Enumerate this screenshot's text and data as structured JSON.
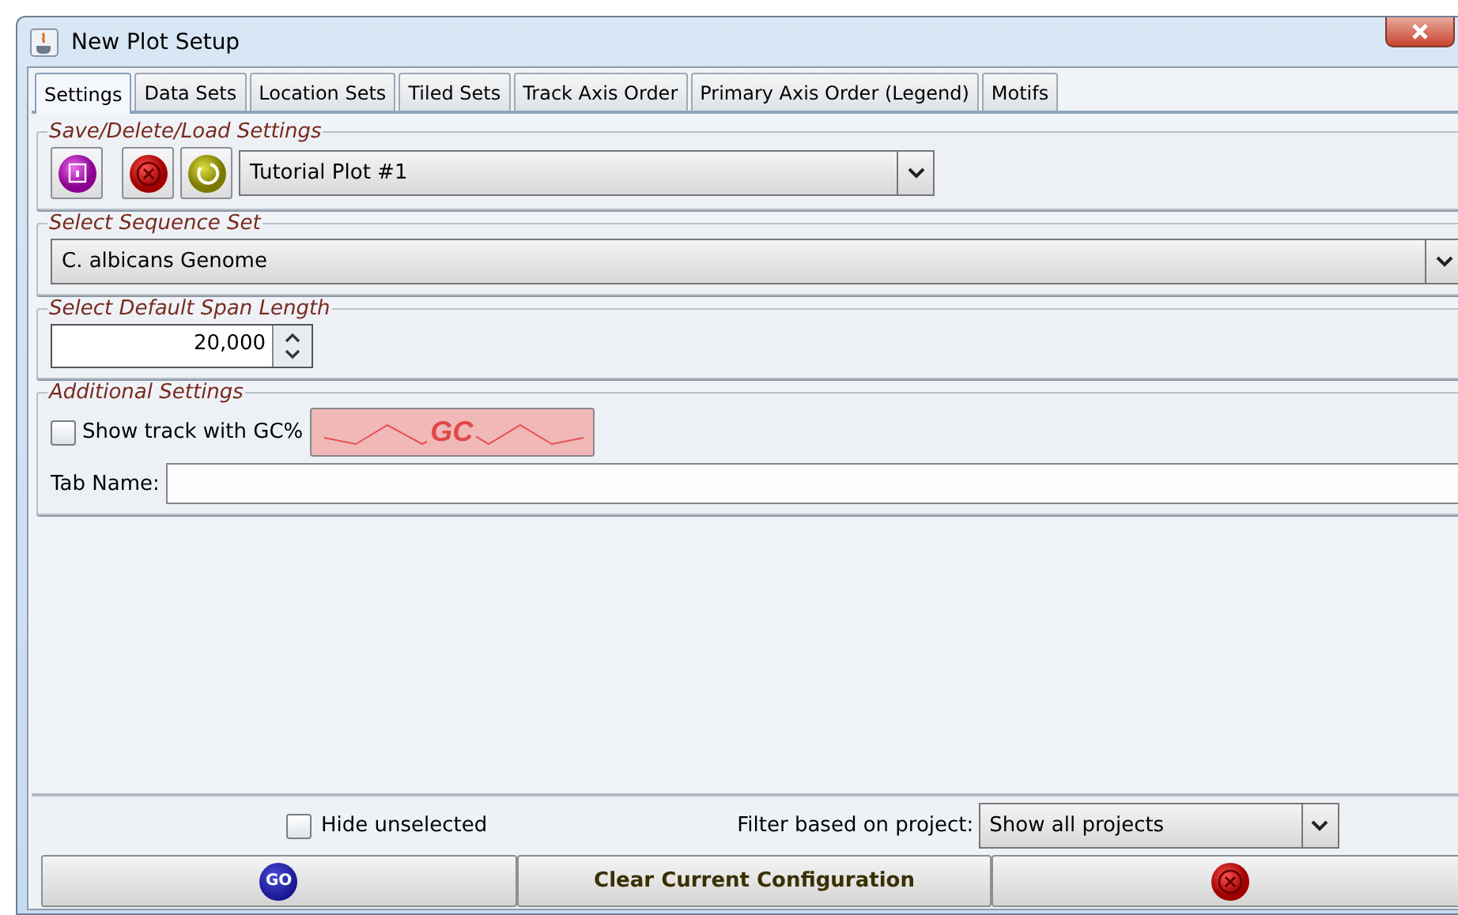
{
  "window": {
    "title": "New Plot Setup"
  },
  "tabs": [
    {
      "label": "Settings",
      "selected": true
    },
    {
      "label": "Data Sets",
      "selected": false
    },
    {
      "label": "Location Sets",
      "selected": false
    },
    {
      "label": "Tiled Sets",
      "selected": false
    },
    {
      "label": "Track Axis Order",
      "selected": false
    },
    {
      "label": "Primary Axis Order (Legend)",
      "selected": false
    },
    {
      "label": "Motifs",
      "selected": false
    }
  ],
  "save_settings": {
    "title": "Save/Delete/Load Settings",
    "selected_setting": "Tutorial Plot #1"
  },
  "sequence_set": {
    "title": "Select Sequence Set",
    "value": "C. albicans Genome"
  },
  "span_length": {
    "title": "Select Default Span Length",
    "value": "20,000"
  },
  "additional": {
    "title": "Additional Settings",
    "gc_label": "Show track with GC%",
    "gc_checked": false,
    "gc_button": "GC",
    "tab_name_label": "Tab Name:"
  },
  "footer": {
    "hide_label": "Hide unselected",
    "hide_checked": false,
    "filter_label": "Filter based on project:",
    "filter_value": "Show all projects",
    "go": "GO",
    "clear": "Clear Current Configuration"
  }
}
